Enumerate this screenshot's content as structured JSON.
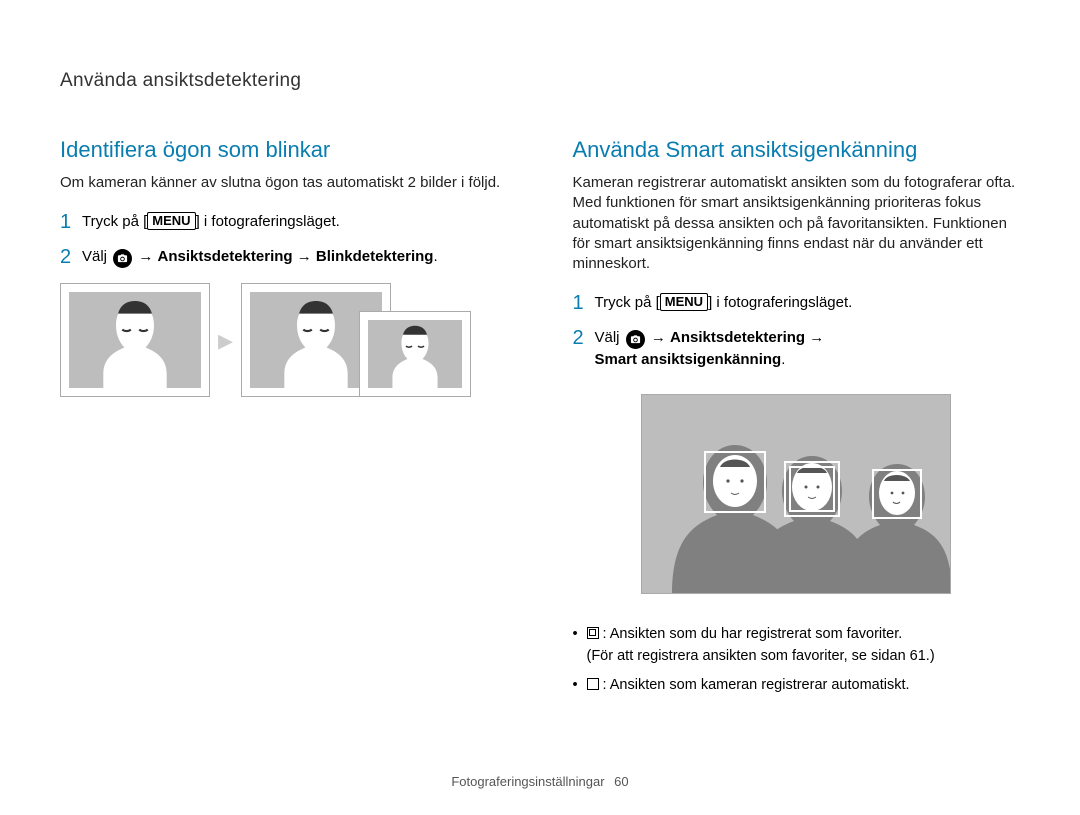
{
  "header": {
    "section": "Använda ansiktsdetektering"
  },
  "left": {
    "heading": "Identifiera ögon som blinkar",
    "intro": "Om kameran känner av slutna ögon tas automatiskt 2 bilder i följd.",
    "step1_pre": "Tryck på [",
    "step1_menu": "MENU",
    "step1_post": "] i fotograferingsläget.",
    "step2_pre": "Välj ",
    "step2_arrow1": " → ",
    "step2_b1": "Ansiktsdetektering",
    "step2_arrow2": " → ",
    "step2_b2": "Blinkdetektering",
    "step2_end": "."
  },
  "right": {
    "heading": "Använda Smart ansiktsigenkänning",
    "intro": "Kameran registrerar automatiskt ansikten som du fotograferar ofta. Med funktionen för smart ansiktsigenkänning prioriteras fokus automatiskt på dessa ansikten och på favoritansikten. Funktionen för smart ansiktsigenkänning finns endast när du använder ett minneskort.",
    "step1_pre": "Tryck på [",
    "step1_menu": "MENU",
    "step1_post": "] i fotograferingsläget.",
    "step2_pre": "Välj ",
    "step2_arrow1": " → ",
    "step2_b1": "Ansiktsdetektering",
    "step2_arrow2": " → ",
    "step2_b2": "Smart ansiktsigenkänning",
    "step2_end": ".",
    "legend1a": ": Ansikten som du har registrerat som favoriter.",
    "legend1b": "(För att registrera ansikten som favoriter, se sidan 61.)",
    "legend2": ": Ansikten som kameran registrerar automatiskt."
  },
  "footer": {
    "label": "Fotograferingsinställningar",
    "page": "60"
  }
}
